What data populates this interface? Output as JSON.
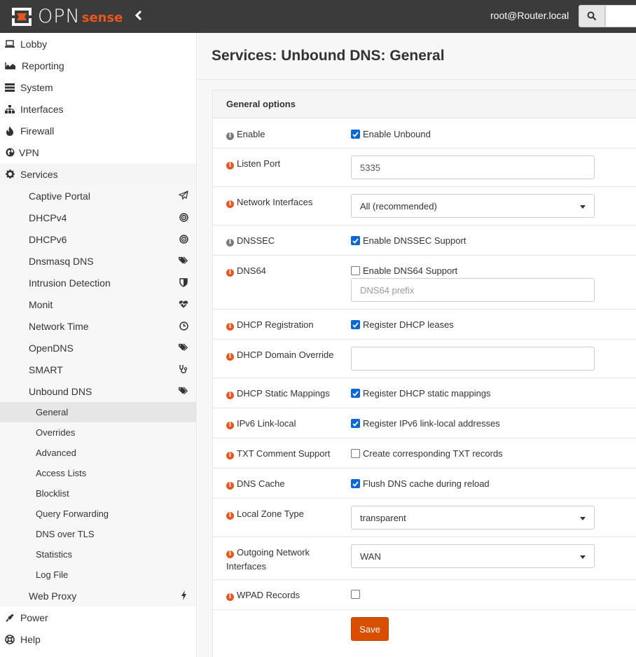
{
  "header": {
    "logo_text": "OPN",
    "logo_accent": "sense",
    "user": "root@Router.local",
    "search_icon": "search-icon",
    "collapse_icon": "chevron-left-icon"
  },
  "sidebar": {
    "top_items": [
      {
        "label": "Lobby",
        "icon": "laptop-icon"
      },
      {
        "label": "Reporting",
        "icon": "area-chart-icon"
      },
      {
        "label": "System",
        "icon": "server-icon"
      },
      {
        "label": "Interfaces",
        "icon": "sitemap-icon"
      },
      {
        "label": "Firewall",
        "icon": "fire-icon"
      },
      {
        "label": "VPN",
        "icon": "globe-icon"
      },
      {
        "label": "Services",
        "icon": "cog-icon"
      }
    ],
    "services_items": [
      {
        "label": "Captive Portal",
        "icon": "paper-plane-icon"
      },
      {
        "label": "DHCPv4",
        "icon": "bullseye-icon"
      },
      {
        "label": "DHCPv6",
        "icon": "bullseye-icon"
      },
      {
        "label": "Dnsmasq DNS",
        "icon": "tags-icon"
      },
      {
        "label": "Intrusion Detection",
        "icon": "shield-icon"
      },
      {
        "label": "Monit",
        "icon": "heartbeat-icon"
      },
      {
        "label": "Network Time",
        "icon": "clock-icon"
      },
      {
        "label": "OpenDNS",
        "icon": "tags-icon"
      },
      {
        "label": "SMART",
        "icon": "stethoscope-icon"
      },
      {
        "label": "Unbound DNS",
        "icon": "tags-icon"
      }
    ],
    "unbound_items": [
      {
        "label": "General",
        "selected": true
      },
      {
        "label": "Overrides"
      },
      {
        "label": "Advanced"
      },
      {
        "label": "Access Lists"
      },
      {
        "label": "Blocklist"
      },
      {
        "label": "Query Forwarding"
      },
      {
        "label": "DNS over TLS"
      },
      {
        "label": "Statistics"
      },
      {
        "label": "Log File"
      }
    ],
    "web_proxy": {
      "label": "Web Proxy",
      "icon": "bolt-icon"
    },
    "bottom_items": [
      {
        "label": "Power",
        "icon": "plug-icon"
      },
      {
        "label": "Help",
        "icon": "life-ring-icon"
      }
    ]
  },
  "main": {
    "title": "Services: Unbound DNS: General",
    "section_title": "General options",
    "save_label": "Save",
    "fields": {
      "enable": {
        "label": "Enable",
        "text": "Enable Unbound",
        "checked": true
      },
      "listen_port": {
        "label": "Listen Port",
        "value": "5335"
      },
      "network_interfaces": {
        "label": "Network Interfaces",
        "value": "All (recommended)"
      },
      "dnssec": {
        "label": "DNSSEC",
        "text": "Enable DNSSEC Support",
        "checked": true
      },
      "dns64": {
        "label": "DNS64",
        "text": "Enable DNS64 Support",
        "checked": false,
        "placeholder": "DNS64 prefix"
      },
      "dhcp_registration": {
        "label": "DHCP Registration",
        "text": "Register DHCP leases",
        "checked": true
      },
      "dhcp_domain_override": {
        "label": "DHCP Domain Override",
        "value": ""
      },
      "dhcp_static": {
        "label": "DHCP Static Mappings",
        "text": "Register DHCP static mappings",
        "checked": true
      },
      "ipv6_link_local": {
        "label": "IPv6 Link-local",
        "text": "Register IPv6 link-local addresses",
        "checked": true
      },
      "txt_comment": {
        "label": "TXT Comment Support",
        "text": "Create corresponding TXT records",
        "checked": false
      },
      "dns_cache": {
        "label": "DNS Cache",
        "text": "Flush DNS cache during reload",
        "checked": true
      },
      "local_zone_type": {
        "label": "Local Zone Type",
        "value": "transparent"
      },
      "outgoing_interfaces": {
        "label": "Outgoing Network Interfaces",
        "value": "WAN"
      },
      "wpad": {
        "label": "WPAD Records",
        "checked": false
      }
    }
  },
  "colors": {
    "accent": "#e8571e",
    "header_bg": "#3b3b3b",
    "checkbox": "#0b66d8",
    "save_button": "#d94f00"
  }
}
